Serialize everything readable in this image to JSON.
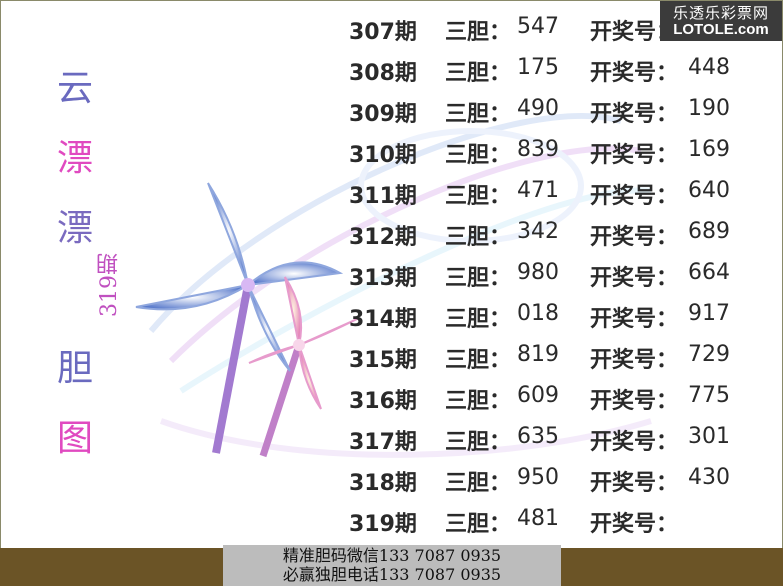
{
  "brand": {
    "cn": "乐透乐彩票网",
    "en": "LOTOLE.com"
  },
  "title": {
    "chars": [
      "云",
      "漂",
      "漂",
      "胆",
      "图"
    ],
    "period": "319期"
  },
  "colors": {
    "title_chars": [
      "#6a6abf",
      "#e04ac0",
      "#7a6abf",
      "#6a6abf",
      "#e04ac0"
    ],
    "footer_band": "#6b5426",
    "footer_box": "#bcbcbc"
  },
  "labels": {
    "three": "三胆：",
    "draw": "开奖号："
  },
  "rows": [
    {
      "period": "307期",
      "three": "547",
      "draw": ""
    },
    {
      "period": "308期",
      "three": "175",
      "draw": "448"
    },
    {
      "period": "309期",
      "three": "490",
      "draw": "190"
    },
    {
      "period": "310期",
      "three": "839",
      "draw": "169"
    },
    {
      "period": "311期",
      "three": "471",
      "draw": "640"
    },
    {
      "period": "312期",
      "three": "342",
      "draw": "689"
    },
    {
      "period": "313期",
      "three": "980",
      "draw": "664"
    },
    {
      "period": "314期",
      "three": "018",
      "draw": "917"
    },
    {
      "period": "315期",
      "three": "819",
      "draw": "729"
    },
    {
      "period": "316期",
      "three": "609",
      "draw": "775"
    },
    {
      "period": "317期",
      "three": "635",
      "draw": "301"
    },
    {
      "period": "318期",
      "three": "950",
      "draw": "430"
    },
    {
      "period": "319期",
      "three": "481",
      "draw": ""
    }
  ],
  "footer": {
    "line1": "精准胆码微信133  7087  0935",
    "line2": "必赢独胆电话133  7087  0935"
  }
}
